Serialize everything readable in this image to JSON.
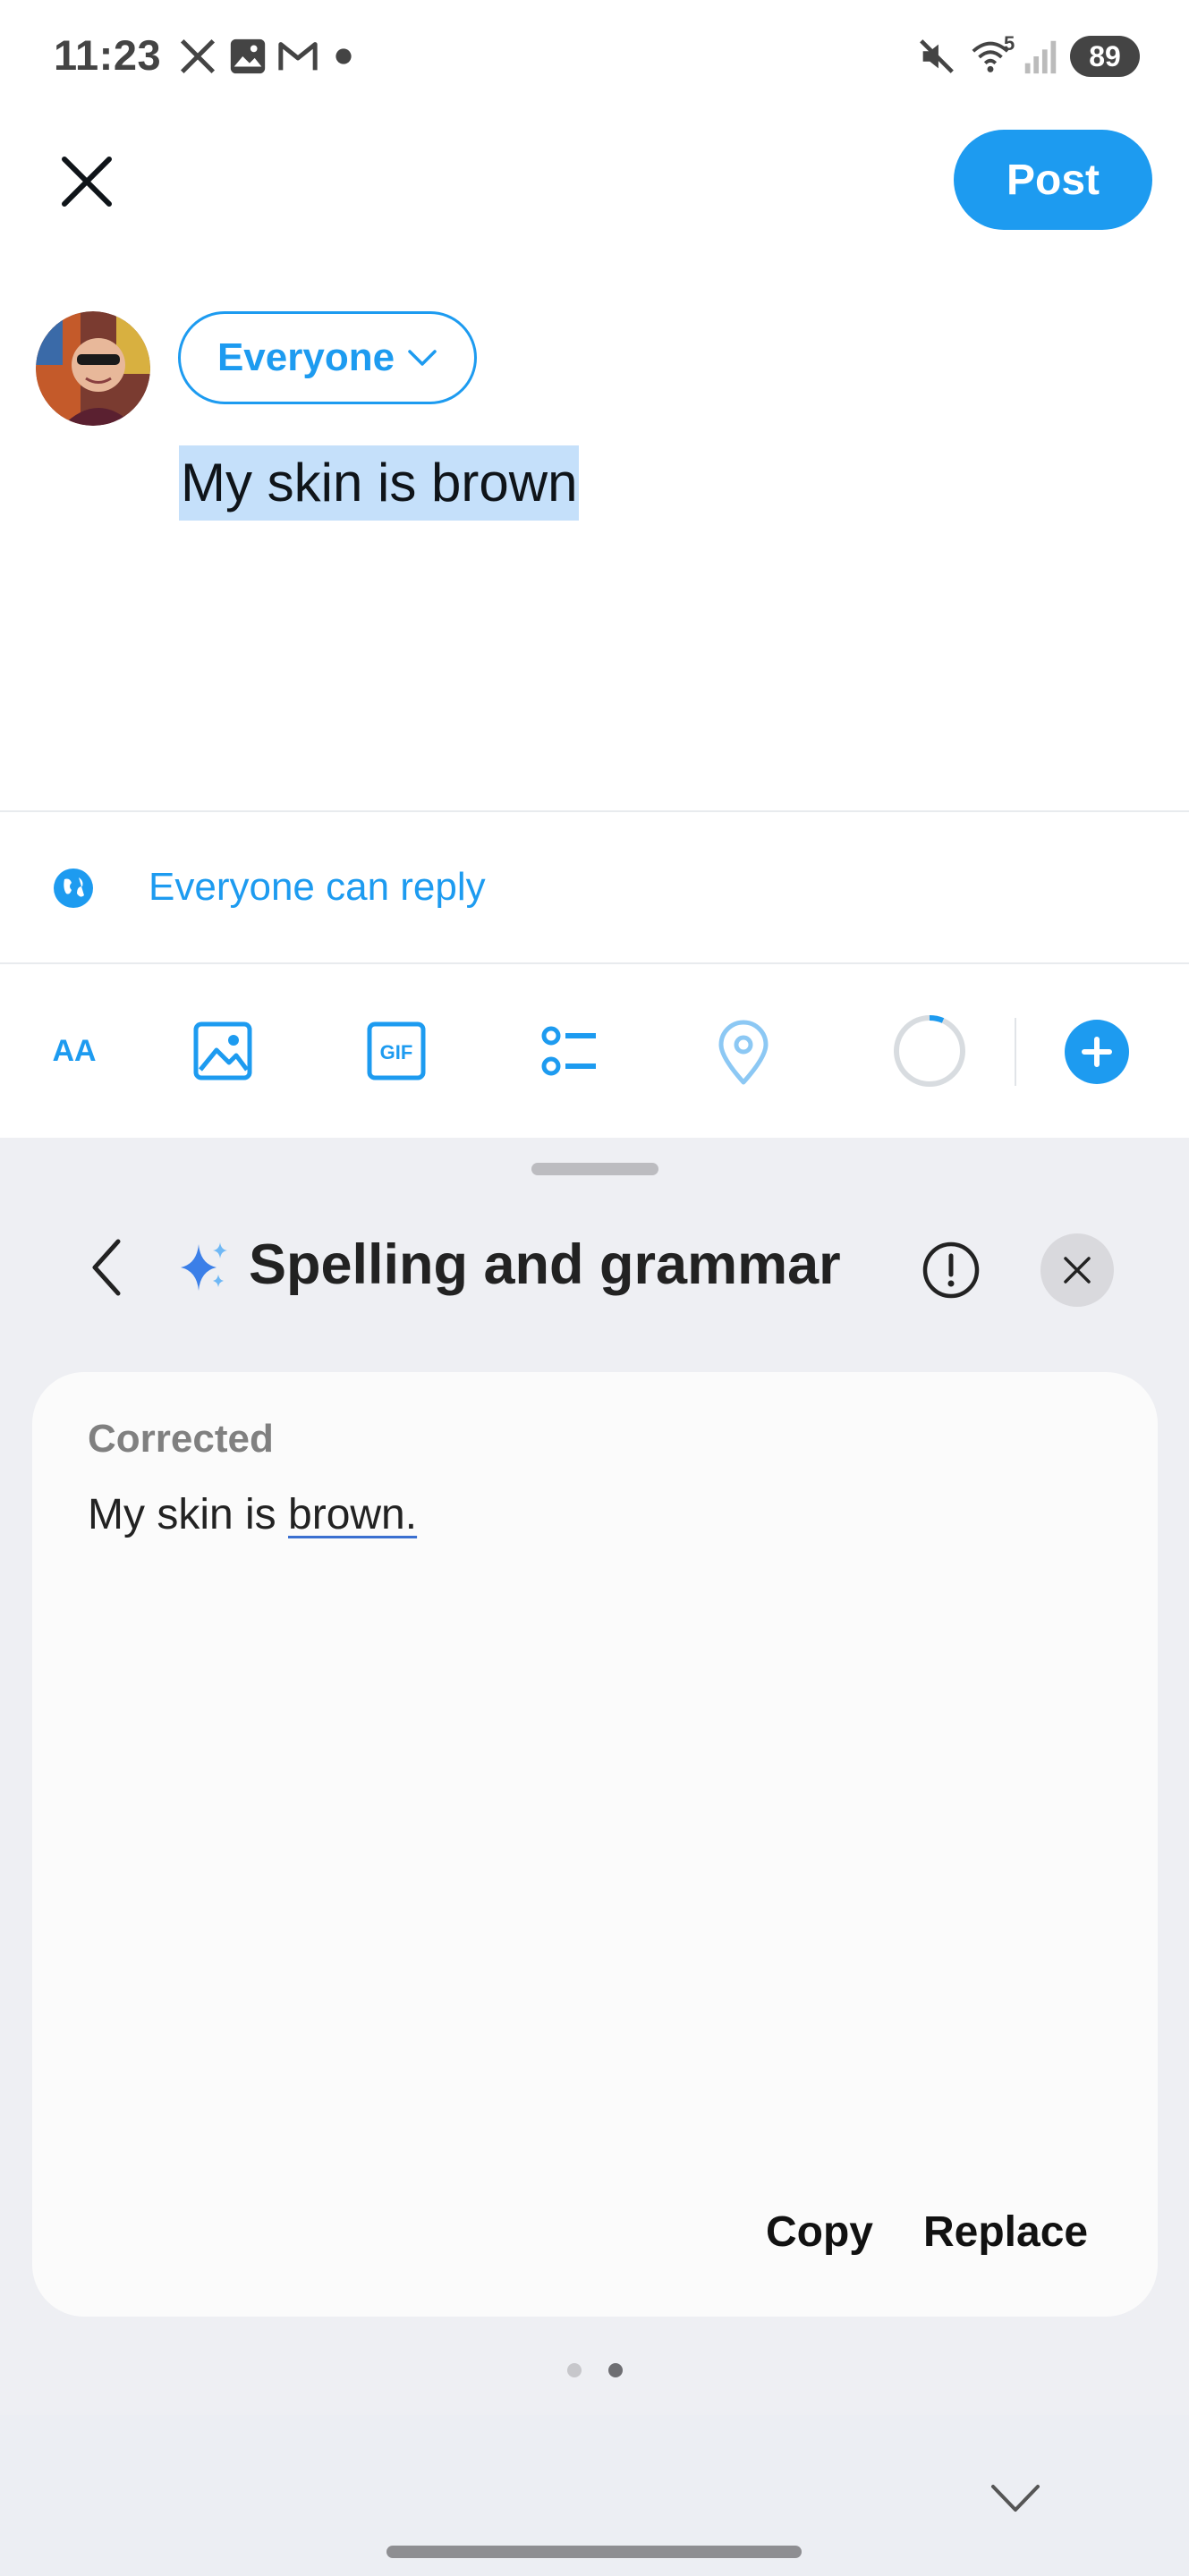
{
  "status_bar": {
    "time": "11:23",
    "icons": [
      "x-logo-icon",
      "gallery-icon",
      "gmail-icon",
      "dot-icon",
      "mute-icon",
      "wifi-icon",
      "signal-icon"
    ],
    "wifi_label": "5",
    "battery": "89"
  },
  "header": {
    "close_icon": "close-icon",
    "post_label": "Post"
  },
  "composer": {
    "audience_label": "Everyone",
    "text": "My skin is brown",
    "reply_setting": "Everyone can reply"
  },
  "toolbar": {
    "items": [
      "text-size-icon",
      "image-icon",
      "gif-icon",
      "poll-icon",
      "location-icon",
      "char-counter-icon",
      "add-post-icon"
    ],
    "text_size_label": "AA",
    "gif_label": "GIF"
  },
  "sheet": {
    "title": "Spelling and grammar",
    "result_heading": "Corrected",
    "corrected_prefix": "My skin is ",
    "corrected_changed": "brown.",
    "copy_label": "Copy",
    "replace_label": "Replace",
    "page_count": 2,
    "active_page": 2
  },
  "colors": {
    "accent": "#1d9bf0",
    "sheet_bg": "#eeeff3",
    "card_bg": "#fbfbfb",
    "highlight": "#c5e0fa"
  }
}
